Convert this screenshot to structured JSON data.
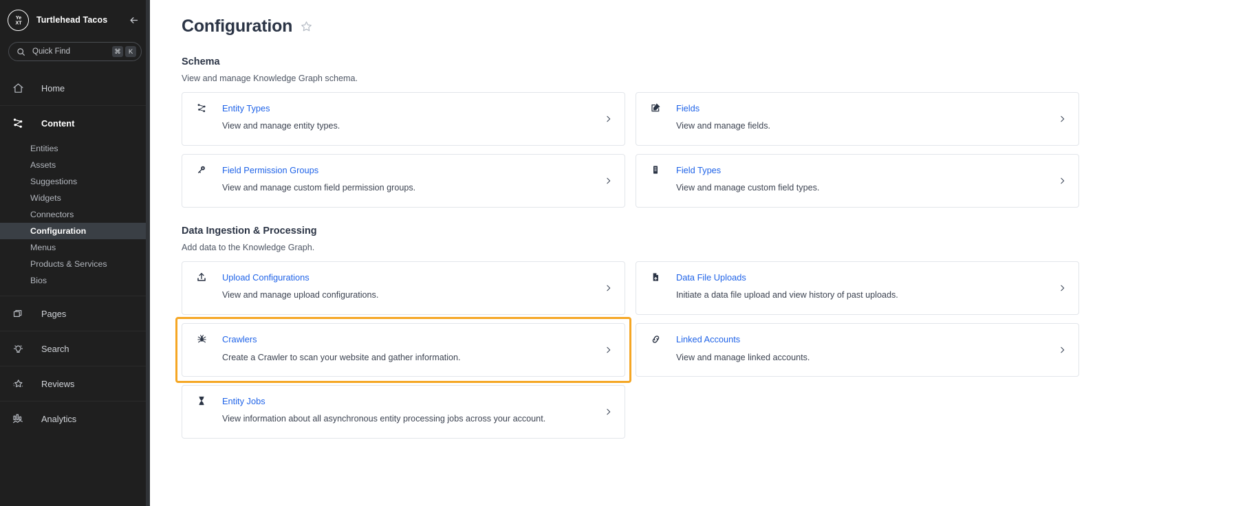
{
  "sidebar": {
    "account_name": "Turtlehead Tacos",
    "logo_text": "Ye XT",
    "collapse_icon": "arrow-left-icon",
    "quick_find": {
      "placeholder": "Quick Find",
      "icon": "search-icon",
      "shortcut_modifier": "⌘",
      "shortcut_key": "K"
    },
    "groups": [
      {
        "label": "Home",
        "icon": "home-icon",
        "active": false,
        "items": []
      },
      {
        "label": "Content",
        "icon": "knowledge-graph-icon",
        "active": true,
        "items": [
          {
            "label": "Entities",
            "selected": false
          },
          {
            "label": "Assets",
            "selected": false
          },
          {
            "label": "Suggestions",
            "selected": false
          },
          {
            "label": "Widgets",
            "selected": false
          },
          {
            "label": "Connectors",
            "selected": false
          },
          {
            "label": "Configuration",
            "selected": true
          },
          {
            "label": "Menus",
            "selected": false
          },
          {
            "label": "Products & Services",
            "selected": false
          },
          {
            "label": "Bios",
            "selected": false
          }
        ]
      },
      {
        "label": "Pages",
        "icon": "pages-icon",
        "active": false,
        "items": []
      },
      {
        "label": "Search",
        "icon": "lightbulb-icon",
        "active": false,
        "items": []
      },
      {
        "label": "Reviews",
        "icon": "star-sparkle-icon",
        "active": false,
        "items": []
      },
      {
        "label": "Analytics",
        "icon": "bar-chart-icon",
        "active": false,
        "items": []
      }
    ]
  },
  "page": {
    "title": "Configuration",
    "favorite_icon": "star-outline-icon"
  },
  "sections": [
    {
      "title": "Schema",
      "description": "View and manage Knowledge Graph schema.",
      "cards": [
        {
          "link": "Entity Types",
          "description": "View and manage entity types.",
          "icon": "knowledge-graph-icon",
          "highlighted": false
        },
        {
          "link": "Fields",
          "description": "View and manage fields.",
          "icon": "edit-box-icon",
          "highlighted": false
        },
        {
          "link": "Field Permission Groups",
          "description": "View and manage custom field permission groups.",
          "icon": "key-icon",
          "highlighted": false
        },
        {
          "link": "Field Types",
          "description": "View and manage custom field types.",
          "icon": "list-document-icon",
          "highlighted": false
        }
      ]
    },
    {
      "title": "Data Ingestion & Processing",
      "description": "Add data to the Knowledge Graph.",
      "cards": [
        {
          "link": "Upload Configurations",
          "description": "View and manage upload configurations.",
          "icon": "upload-icon",
          "highlighted": false
        },
        {
          "link": "Data File Uploads",
          "description": "Initiate a data file upload and view history of past uploads.",
          "icon": "file-upload-icon",
          "highlighted": false
        },
        {
          "link": "Crawlers",
          "description": "Create a Crawler to scan your website and gather information.",
          "icon": "spider-icon",
          "highlighted": true
        },
        {
          "link": "Linked Accounts",
          "description": "View and manage linked accounts.",
          "icon": "link-icon",
          "highlighted": false
        },
        {
          "link": "Entity Jobs",
          "description": "View information about all asynchronous entity processing jobs across your account.",
          "icon": "hourglass-icon",
          "highlighted": false
        }
      ]
    }
  ],
  "colors": {
    "sidebar_bg": "#1f1f1f",
    "sidebar_selected_bg": "#3a3f45",
    "link_blue": "#1f63e8",
    "highlight_orange": "#f5a623",
    "heading": "#2b3445"
  },
  "chevron_icon": "chevron-right-icon"
}
